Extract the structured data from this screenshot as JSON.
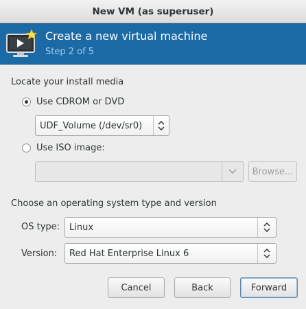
{
  "window": {
    "title": "New VM (as superuser)"
  },
  "banner": {
    "title": "Create a new virtual machine",
    "step": "Step 2 of 5",
    "icon": "vm-monitor-star-icon"
  },
  "install_media": {
    "heading": "Locate your install media",
    "cdrom_label": "Use CDROM or DVD",
    "cdrom_checked": true,
    "cdrom_device": "UDF_Volume (/dev/sr0)",
    "iso_label": "Use ISO image:",
    "iso_checked": false,
    "iso_path": "",
    "browse_label": "Browse..."
  },
  "os": {
    "heading": "Choose an operating system type and version",
    "type_label": "OS type:",
    "type_value": "Linux",
    "version_label": "Version:",
    "version_value": "Red Hat Enterprise Linux 6"
  },
  "buttons": {
    "cancel": "Cancel",
    "back": "Back",
    "forward": "Forward"
  },
  "colors": {
    "banner_bg": "#1b6aa5",
    "banner_step": "#9ecbf0"
  }
}
